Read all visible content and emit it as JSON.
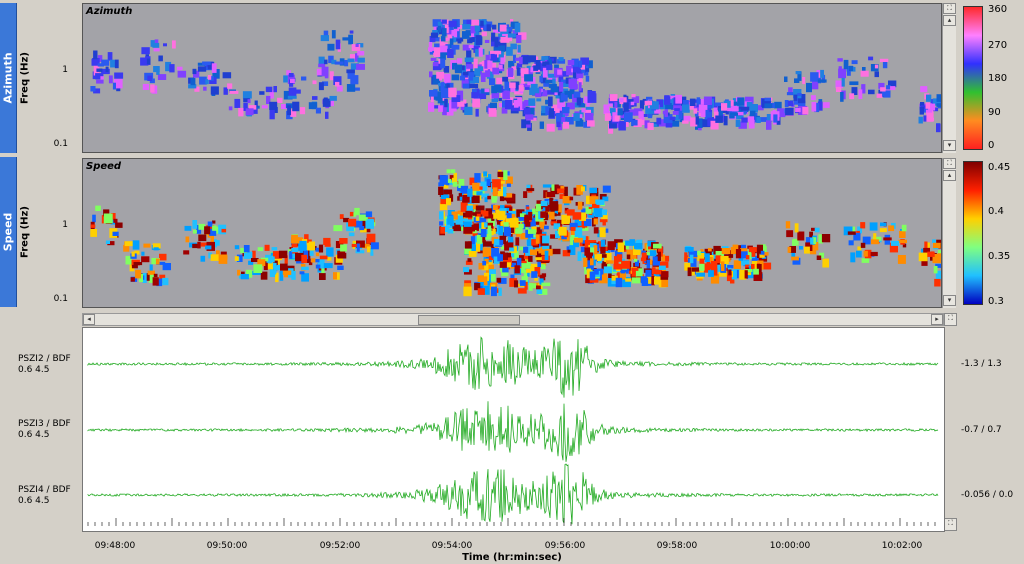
{
  "tabs": [
    {
      "label": "Azimuth"
    },
    {
      "label": "Speed"
    }
  ],
  "azimuth_panel": {
    "title": "Azimuth",
    "ylabel": "Freq (Hz)",
    "yticks": [
      "1",
      "0.1"
    ],
    "colorbar": {
      "labels": [
        "360",
        "270",
        "180",
        "90",
        "0"
      ],
      "colors": [
        "#ff2a2a",
        "#ff80ff",
        "#3030ff",
        "#30c030",
        "#ff8c20",
        "#ff2020"
      ]
    }
  },
  "speed_panel": {
    "title": "Speed",
    "ylabel": "Freq (Hz)",
    "yticks": [
      "1",
      "0.1"
    ],
    "colorbar": {
      "labels": [
        "0.45",
        "0.4",
        "0.35",
        "0.3"
      ],
      "colors": [
        "#800000",
        "#ff2000",
        "#ffd000",
        "#80ff80",
        "#20c0ff",
        "#0000c0"
      ]
    }
  },
  "channels": [
    {
      "name": "PSZI2 / BDF",
      "filter": "0.6 4.5",
      "amplitude": "-1.3 / 1.3"
    },
    {
      "name": "PSZI3 / BDF",
      "filter": "0.6 4.5",
      "amplitude": "-0.7 / 0.7"
    },
    {
      "name": "PSZI4 / BDF",
      "filter": "0.6 4.5",
      "amplitude": "-0.056 / 0.0"
    }
  ],
  "time_axis": {
    "title": "Time (hr:min:sec)",
    "ticks": [
      "09:48:00",
      "09:50:00",
      "09:52:00",
      "09:54:00",
      "09:56:00",
      "09:58:00",
      "10:00:00",
      "10:02:00"
    ]
  },
  "scroll_buttons": {
    "left": "◂",
    "right": "▸",
    "up": "▴",
    "down": "▾"
  },
  "colors": {
    "waveform": "#22aa22",
    "tab": "#3b78d8",
    "plot_bg": "#a3a3a8"
  }
}
